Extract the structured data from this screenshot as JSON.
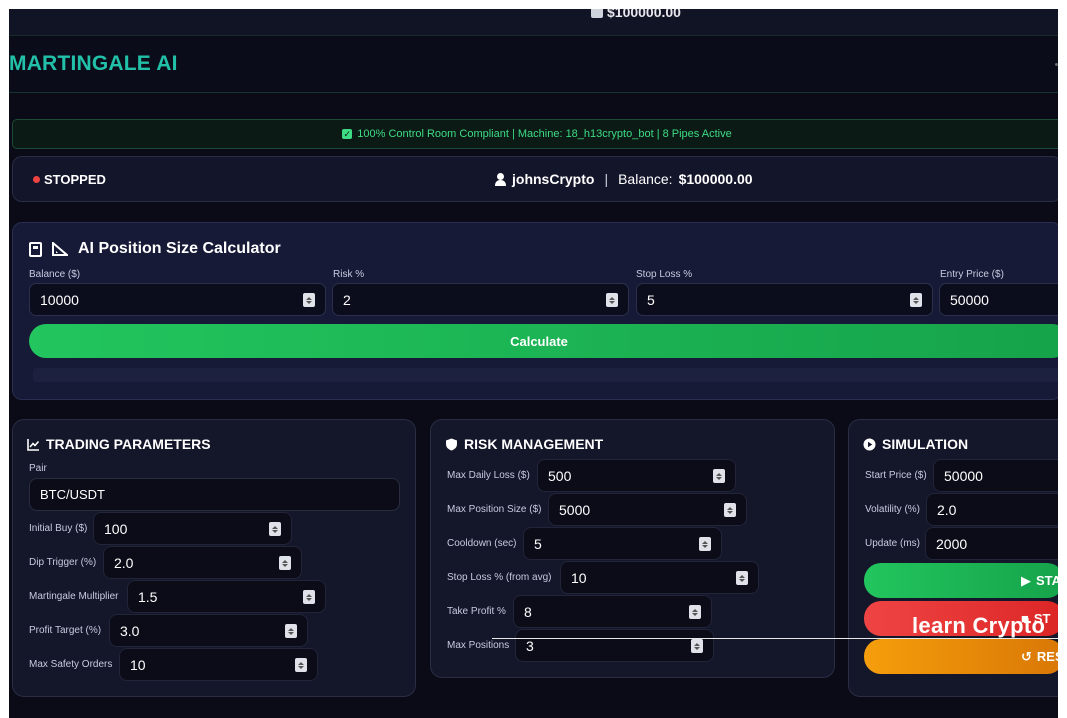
{
  "top_strip": {
    "balance": "$100000.00"
  },
  "brand": "MARTINGALE AI",
  "compliance": {
    "text": "100% Control Room Compliant | Machine: 18_h13crypto_bot | 8 Pipes Active"
  },
  "status": {
    "state": "STOPPED",
    "username": "johnsCrypto",
    "balance_label": "Balance:",
    "balance_value": "$100000.00"
  },
  "calculator": {
    "title": "AI Position Size Calculator",
    "fields": [
      {
        "label": "Balance ($)",
        "value": "10000"
      },
      {
        "label": "Risk %",
        "value": "2"
      },
      {
        "label": "Stop Loss %",
        "value": "5"
      },
      {
        "label": "Entry Price ($)",
        "value": "50000"
      }
    ],
    "button": "Calculate"
  },
  "trading": {
    "title": "TRADING PARAMETERS",
    "pair_label": "Pair",
    "pair_value": "BTC/USDT",
    "fields": [
      {
        "label": "Initial Buy ($)",
        "value": "100"
      },
      {
        "label": "Dip Trigger (%)",
        "value": "2.0"
      },
      {
        "label": "Martingale Multiplier",
        "value": "1.5"
      },
      {
        "label": "Profit Target (%)",
        "value": "3.0"
      },
      {
        "label": "Max Safety Orders",
        "value": "10"
      }
    ]
  },
  "risk": {
    "title": "RISK MANAGEMENT",
    "fields": [
      {
        "label": "Max Daily Loss ($)",
        "value": "500"
      },
      {
        "label": "Max Position Size ($)",
        "value": "5000"
      },
      {
        "label": "Cooldown (sec)",
        "value": "5"
      },
      {
        "label": "Stop Loss % (from avg)",
        "value": "10"
      },
      {
        "label": "Take Profit %",
        "value": "8"
      },
      {
        "label": "Max Positions",
        "value": "3"
      }
    ]
  },
  "simulation": {
    "title": "SIMULATION",
    "fields": [
      {
        "label": "Start Price ($)",
        "value": "50000"
      },
      {
        "label": "Volatility (%)",
        "value": "2.0"
      },
      {
        "label": "Update (ms)",
        "value": "2000"
      }
    ],
    "buttons": {
      "start": "STA",
      "stop": "ST",
      "reset": "RES"
    },
    "colors": {
      "start": "#22c55e",
      "stop": "#ef4444",
      "reset": "#f59e0b"
    }
  },
  "overlay": {
    "text": "learn Crypto"
  }
}
